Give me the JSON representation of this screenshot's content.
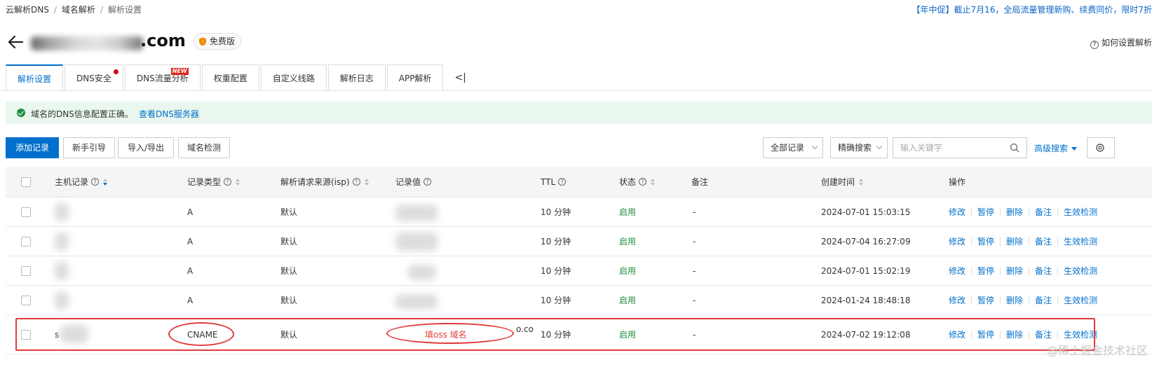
{
  "breadcrumb": [
    "云解析DNS",
    "域名解析",
    "解析设置"
  ],
  "promo_text": "【年中促】截止7月16，全局流量管理新购、续费同价，限时7折",
  "domain_suffix": ".com",
  "plan_badge": "免费版",
  "help_link": "如何设置解析",
  "tabs": [
    {
      "label": "解析设置",
      "active": true
    },
    {
      "label": "DNS安全",
      "dot": true
    },
    {
      "label": "DNS流量分析",
      "badge": "NEW"
    },
    {
      "label": "权重配置"
    },
    {
      "label": "自定义线路"
    },
    {
      "label": "解析日志"
    },
    {
      "label": "APP解析"
    }
  ],
  "tab_collapse": "<|",
  "notice": {
    "message": "域名的DNS信息配置正确。",
    "link": "查看DNS服务器"
  },
  "toolbar": {
    "add": "添加记录",
    "guide": "新手引导",
    "import_export": "导入/导出",
    "check": "域名检测",
    "filter": "全部记录",
    "search_mode": "精确搜索",
    "search_placeholder": "输入关键字",
    "advanced": "高级搜索"
  },
  "columns": {
    "host": "主机记录",
    "type": "记录类型",
    "isp": "解析请求来源(isp)",
    "value": "记录值",
    "ttl": "TTL",
    "status": "状态",
    "remark": "备注",
    "created": "创建时间",
    "ops": "操作"
  },
  "rows": [
    {
      "host": "",
      "type": "A",
      "isp": "默认",
      "value": "",
      "ttl": "10 分钟",
      "status": "启用",
      "remark": "-",
      "created": "2024-07-01 15:03:15"
    },
    {
      "host": "",
      "type": "A",
      "isp": "默认",
      "value": "",
      "ttl": "10 分钟",
      "status": "启用",
      "remark": "-",
      "created": "2024-07-04 16:27:09"
    },
    {
      "host": "",
      "type": "A",
      "isp": "默认",
      "value": "",
      "ttl": "10 分钟",
      "status": "启用",
      "remark": "-",
      "created": "2024-07-01 15:02:19"
    },
    {
      "host": "",
      "type": "A",
      "isp": "默认",
      "value": "",
      "ttl": "10 分钟",
      "status": "启用",
      "remark": "-",
      "created": "2024-01-24 18:48:18"
    },
    {
      "host": "s",
      "type": "CNAME",
      "isp": "默认",
      "value": "o.co",
      "ttl": "10 分钟",
      "status": "启用",
      "remark": "-",
      "created": "2024-07-02 19:12:08"
    }
  ],
  "row_actions": [
    "修改",
    "暂停",
    "删除",
    "备注",
    "生效检测"
  ],
  "annotation": "填oss 域名",
  "watermark": "@稀土掘金技术社区",
  "colors": {
    "primary": "#0070cc",
    "success": "#1e8e3e",
    "annotation": "#e23b3b"
  }
}
